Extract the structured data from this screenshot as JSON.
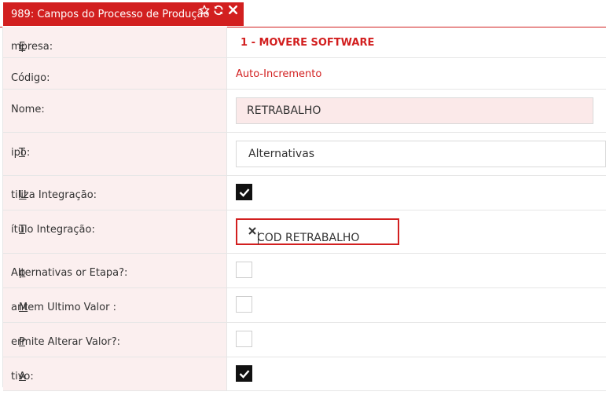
{
  "tab": {
    "title": "989: Campos do Processo de Produção",
    "icons": [
      "star-icon",
      "refresh-icon",
      "close-icon"
    ],
    "color": "#d21f1f"
  },
  "form": {
    "empresa": {
      "label": "Empresa:",
      "value": "1 - MOVERE SOFTWARE"
    },
    "codigo": {
      "label": "Código:",
      "value": "Auto-Incremento"
    },
    "nome": {
      "label": "Nome:",
      "value": "RETRABALHO"
    },
    "tipo": {
      "label": "Tipo:",
      "value": "Alternativas"
    },
    "utiliza_integracao": {
      "label": "Utiliza Integração:",
      "checked": true
    },
    "titulo_integracao": {
      "label": "Título Integração:",
      "value": "COD RETRABALHO"
    },
    "alternativas_por_etapa": {
      "label": "Alternativas por Etapa?:",
      "checked": false
    },
    "mantem_ultimo_valor": {
      "label": "Mantem Ultimo Valor :",
      "checked": false
    },
    "permite_alterar_valor": {
      "label": "Permite Alterar Valor?:",
      "checked": false
    },
    "ativo": {
      "label": "Ativo:",
      "checked": true
    }
  }
}
